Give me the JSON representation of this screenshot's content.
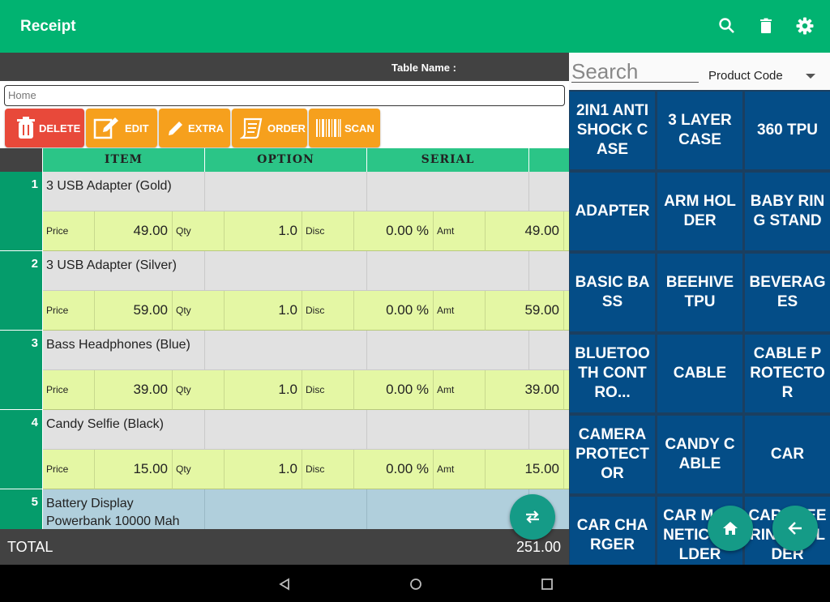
{
  "header": {
    "title": "Receipt",
    "icons": [
      "search-icon",
      "trash-icon",
      "gear-icon"
    ]
  },
  "table_name_label": "Table Name :",
  "home_field": {
    "placeholder": "Home"
  },
  "actions": {
    "delete": "DELETE",
    "edit": "EDIT",
    "extra": "EXTRA",
    "order": "ORDER",
    "scan": "SCAN"
  },
  "columns": {
    "item": "ITEM",
    "option": "OPTION",
    "serial": "SERIAL"
  },
  "field_labels": {
    "price": "Price",
    "qty": "Qty",
    "disc": "Disc",
    "amt": "Amt"
  },
  "rows": [
    {
      "num": "1",
      "name": "3 USB Adapter (Gold)",
      "price": "49.00",
      "qty": "1.0",
      "disc": "0.00 %",
      "amt": "49.00"
    },
    {
      "num": "2",
      "name": "3 USB Adapter (Silver)",
      "price": "59.00",
      "qty": "1.0",
      "disc": "0.00 %",
      "amt": "59.00"
    },
    {
      "num": "3",
      "name": "Bass Headphones (Blue)",
      "price": "39.00",
      "qty": "1.0",
      "disc": "0.00 %",
      "amt": "39.00"
    },
    {
      "num": "4",
      "name": "Candy Selfie (Black)",
      "price": "15.00",
      "qty": "1.0",
      "disc": "0.00 %",
      "amt": "15.00"
    },
    {
      "num": "5",
      "name": "Battery Display Powerbank 10000 Mah"
    }
  ],
  "total": {
    "label": "TOTAL",
    "value": "251.00"
  },
  "search": {
    "placeholder": "Search"
  },
  "filter": {
    "selected": "Product Code"
  },
  "categories": [
    "2IN1 ANTISHOCK CASE",
    "3 LAYER CASE",
    "360 TPU",
    "ADAPTER",
    "ARM HOLDER",
    "BABY RING STAND",
    "BASIC BASS",
    "BEEHIVE TPU",
    "BEVERAGES",
    "BLUETOOTH CONTRO...",
    "CABLE",
    "CABLE PROTECTOR",
    "CAMERA PROTECTOR",
    "CANDY CABLE",
    "CAR",
    "CAR CHARGER",
    "CAR MAGNETIC HOLDER",
    "CAR STEERING HOLDER"
  ],
  "colors": {
    "primary": "#01b371",
    "tile": "#044d87",
    "fab": "#159b87",
    "row_price": "#e4f7a4"
  }
}
